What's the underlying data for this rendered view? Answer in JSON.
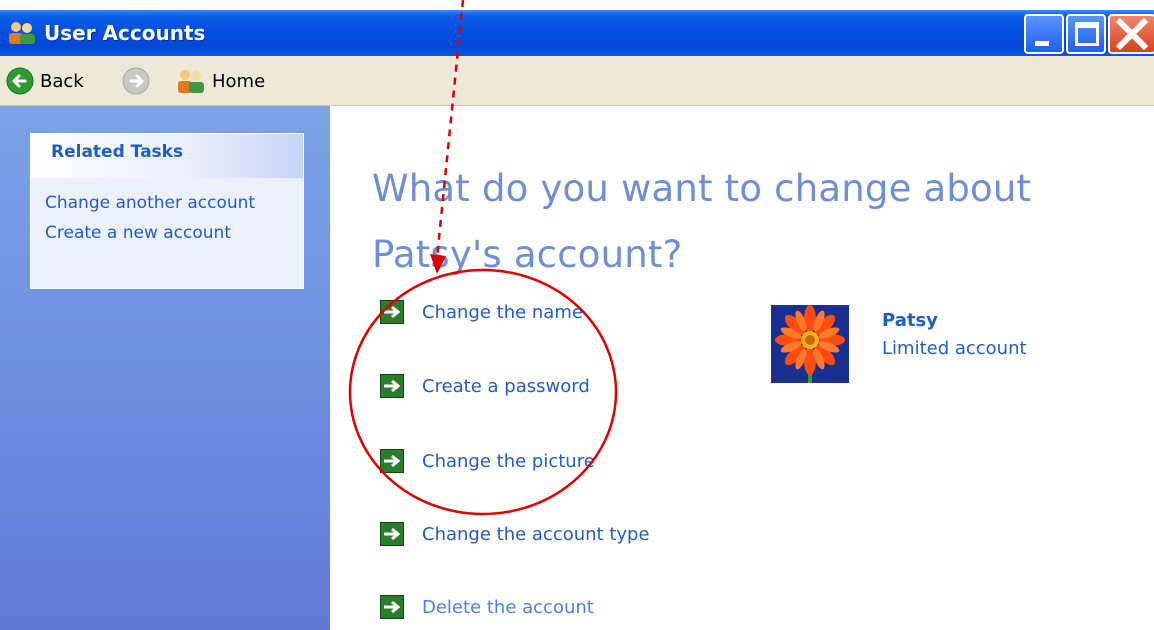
{
  "window": {
    "title": "User Accounts",
    "icon": "users-icon",
    "controls": [
      "minimize",
      "maximize",
      "close"
    ]
  },
  "toolbar": {
    "back_label": "Back",
    "forward_icon": "forward-arrow-icon",
    "home_label": "Home"
  },
  "sidebar": {
    "heading": "Related Tasks",
    "links": [
      "Change another account",
      "Create a new account"
    ]
  },
  "main": {
    "heading_line1": "What do you want to change about",
    "heading_line2": "Patsy's account?",
    "actions": [
      "Change the name",
      "Create a password",
      "Change the picture",
      "Change the account type",
      "Delete the account"
    ],
    "account": {
      "name": "Patsy",
      "type": "Limited account",
      "picture": "orange-flower"
    }
  },
  "colors": {
    "title_bar": "#0450e0",
    "toolbar": "#ece9d8",
    "sidebar": "#6f8fe0",
    "link": "#215dc6",
    "heading": "#6d8fd6",
    "action_arrow": "#2b7d2b",
    "annotation": "#e00000"
  }
}
